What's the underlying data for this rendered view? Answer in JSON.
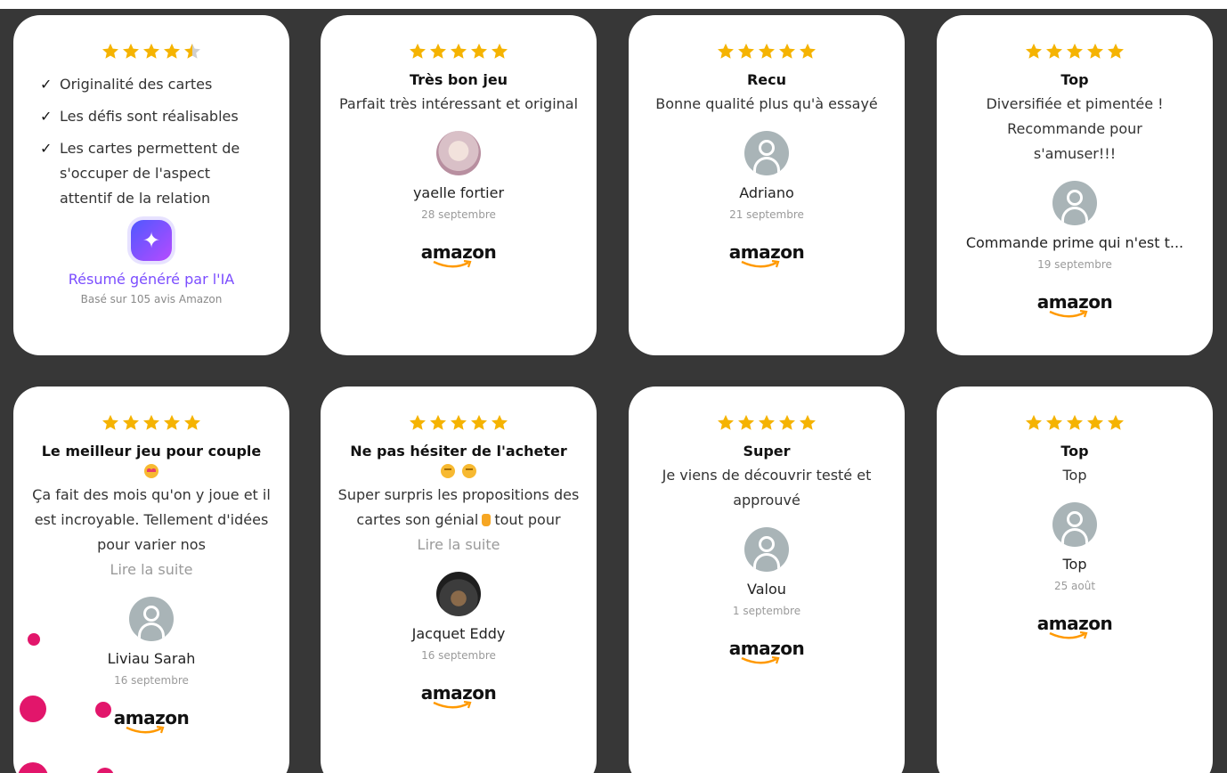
{
  "colors": {
    "star": "#f5b301",
    "background": "#373737",
    "accent_ai": "#7b4dff",
    "dots": "#e2166b"
  },
  "summary_card": {
    "rating": 4.5,
    "checks": [
      "Originalité des cartes",
      "Les défis sont réalisables",
      "Les cartes permettent de s'occuper de l'aspect attentif de la relation"
    ],
    "ai_icon": "sparkles-icon",
    "ai_label": "Résumé généré par l'IA",
    "ai_sub": "Basé sur 105 avis Amazon"
  },
  "brand": {
    "logo": "amazon"
  },
  "reviews": [
    {
      "rating": 5,
      "title": "Très bon jeu",
      "text": "Parfait très intéressant et original",
      "name": "yaelle fortier",
      "date": "28 septembre",
      "avatar": "photo"
    },
    {
      "rating": 5,
      "title": "Recu",
      "text": "Bonne qualité plus qu'à essayé",
      "name": "Adriano",
      "date": "21 septembre",
      "avatar": "default"
    },
    {
      "rating": 5,
      "title": "Top",
      "text": "Diversifiée et pimentée ! Recommande pour s'amuser!!!",
      "name": "Commande prime qui n'est t...",
      "date": "19 septembre",
      "avatar": "default"
    },
    {
      "rating": 5,
      "title": "Le meilleur jeu pour couple",
      "text": "Ça fait des mois qu'on y joue et il est incroyable. Tellement d'idées pour varier nos",
      "read_more": "Lire la suite",
      "name": "Liviau Sarah",
      "date": "16 septembre",
      "avatar": "default"
    },
    {
      "rating": 5,
      "title": "Ne pas hésiter de l'acheter",
      "text_a": "Super surpris les propositions des cartes son génial",
      "text_b": "tout pour",
      "read_more": "Lire la suite",
      "name": "Jacquet Eddy",
      "date": "16 septembre",
      "avatar": "photo"
    },
    {
      "rating": 5,
      "title": "Super",
      "text": "Je viens de découvrir testé et approuvé",
      "name": "Valou",
      "date": "1 septembre",
      "avatar": "default"
    },
    {
      "rating": 5,
      "title": "Top",
      "text": "Top",
      "name": "Top",
      "date": "25 août",
      "avatar": "default"
    }
  ]
}
